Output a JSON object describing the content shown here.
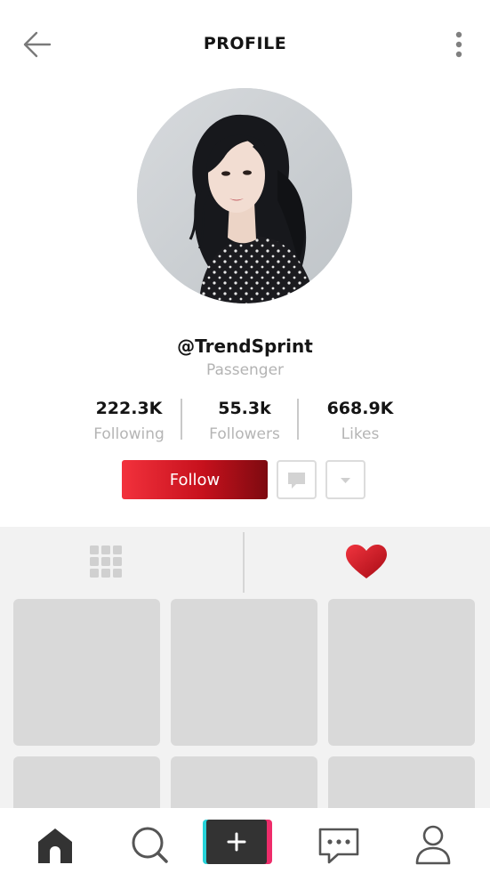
{
  "header": {
    "title": "PROFILE",
    "back_icon": "arrow-left-icon",
    "more_icon": "more-vertical-icon"
  },
  "profile": {
    "avatar": "profile-photo",
    "username": "@TrendSprint",
    "subtitle": "Passenger"
  },
  "stats": [
    {
      "value": "222.3K",
      "label": "Following"
    },
    {
      "value": "55.3k",
      "label": "Followers"
    },
    {
      "value": "668.9K",
      "label": "Likes"
    }
  ],
  "actions": {
    "follow_label": "Follow",
    "message_icon": "message-icon",
    "dropdown_icon": "caret-down-icon"
  },
  "tabs": [
    {
      "icon": "grid-icon",
      "active": false
    },
    {
      "icon": "heart-icon",
      "active": true
    }
  ],
  "colors": {
    "accent": "#e3222c",
    "tile": "#d9d9d9",
    "panel": "#f2f2f2",
    "icon": "#333333"
  },
  "bottom_nav": [
    {
      "icon": "home-icon"
    },
    {
      "icon": "search-icon"
    },
    {
      "icon": "plus-icon"
    },
    {
      "icon": "chat-icon"
    },
    {
      "icon": "user-icon"
    }
  ]
}
